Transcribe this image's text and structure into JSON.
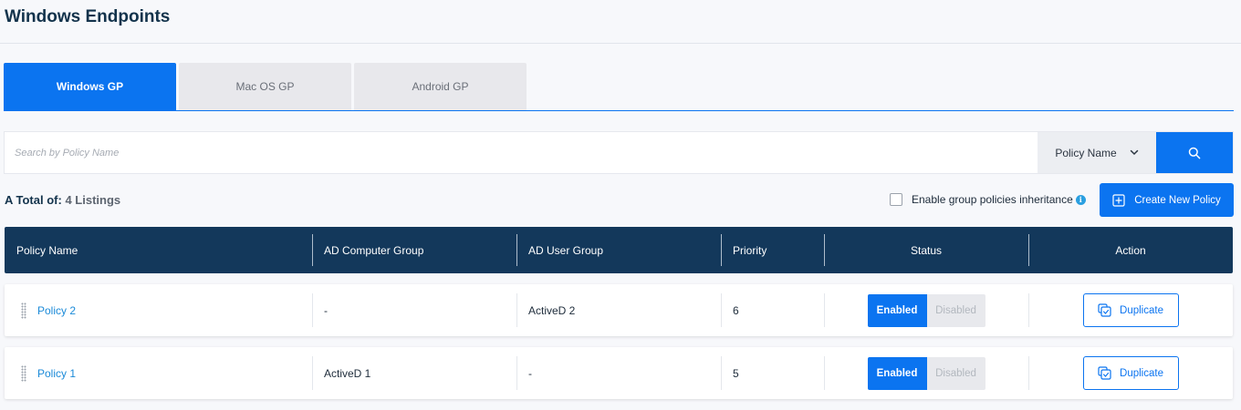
{
  "page": {
    "title": "Windows Endpoints"
  },
  "tabs": [
    {
      "label": "Windows GP",
      "active": true
    },
    {
      "label": "Mac OS GP",
      "active": false
    },
    {
      "label": "Android GP",
      "active": false
    }
  ],
  "search": {
    "placeholder": "Search by Policy Name",
    "value": "",
    "select_value": "Policy Name",
    "button_icon": "search-icon"
  },
  "summary": {
    "label": "A Total of:",
    "count": "4 Listings"
  },
  "inherit": {
    "label": "Enable group policies inheritance",
    "checked": false,
    "info_icon": "info-icon"
  },
  "create_button": {
    "label": "Create New Policy",
    "icon": "plus-square-icon"
  },
  "table": {
    "headers": [
      "Policy Name",
      "AD Computer Group",
      "AD User Group",
      "Priority",
      "Status",
      "Action"
    ],
    "rows": [
      {
        "policy_name": "Policy 2",
        "ad_computer_group": "-",
        "ad_user_group": "ActiveD 2",
        "priority": "6",
        "status_enabled": "Enabled",
        "status_disabled": "Disabled",
        "action": "Duplicate"
      },
      {
        "policy_name": "Policy 1",
        "ad_computer_group": "ActiveD 1",
        "ad_user_group": "-",
        "priority": "5",
        "status_enabled": "Enabled",
        "status_disabled": "Disabled",
        "action": "Duplicate"
      }
    ]
  },
  "colors": {
    "accent": "#0b74f0",
    "header_bg": "#13385b",
    "link": "#1b8ad8"
  }
}
